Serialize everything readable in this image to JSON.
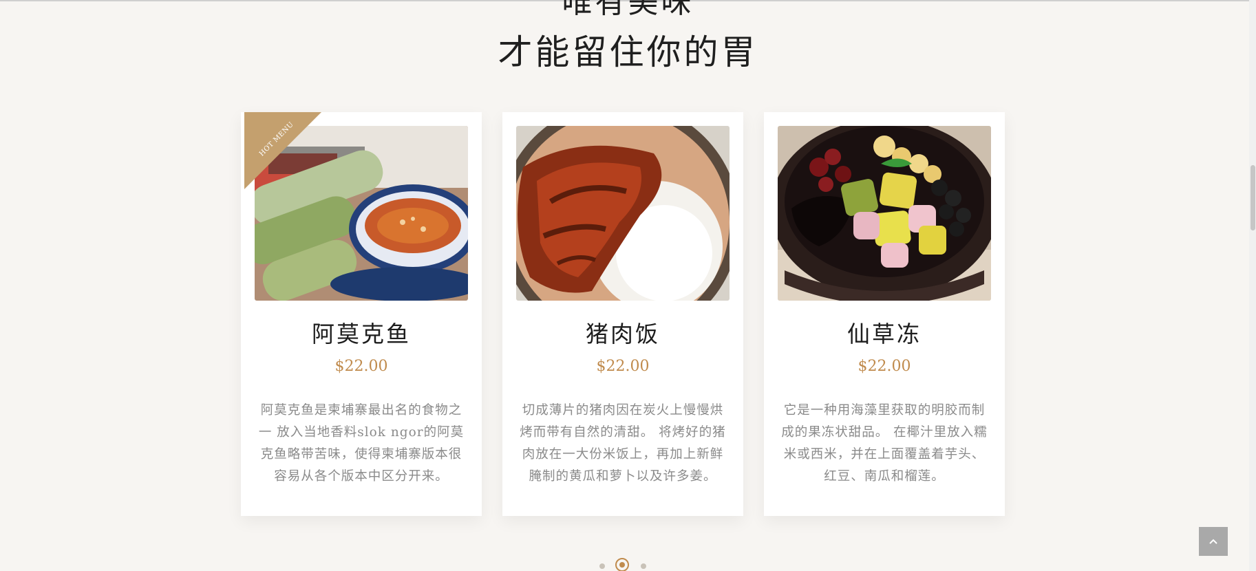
{
  "heading": {
    "line1": "唯有美味",
    "line2": "才能留住你的胃"
  },
  "menu": {
    "badge": "HOT MENU",
    "items": [
      {
        "name": "阿莫克鱼",
        "price": "$22.00",
        "description": "阿莫克鱼是柬埔寨最出名的食物之一 放入当地香料slok ngor的阿莫克鱼略带苦味，使得柬埔寨版本很容易从各个版本中区分开来。"
      },
      {
        "name": "猪肉饭",
        "price": "$22.00",
        "description": "切成薄片的猪肉因在炭火上慢慢烘烤而带有自然的清甜。 将烤好的猪肉放在一大份米饭上，再加上新鲜腌制的黄瓜和萝卜以及许多姜。"
      },
      {
        "name": "仙草冻",
        "price": "$22.00",
        "description": "它是一种用海藻里获取的明胶而制成的果冻状甜品。 在椰汁里放入糯米或西米，并在上面覆盖着芋头、红豆、南瓜和榴莲。"
      }
    ]
  },
  "pager": {
    "total": 3,
    "active": 2
  },
  "colors": {
    "accent": "#c08b4d",
    "background": "#f7f5f2",
    "text": "#1d1d1d",
    "muted": "#8a8a8a",
    "back_to_top": "#a9a9a9"
  },
  "icons": {
    "back_to_top": "chevron-up-icon"
  }
}
